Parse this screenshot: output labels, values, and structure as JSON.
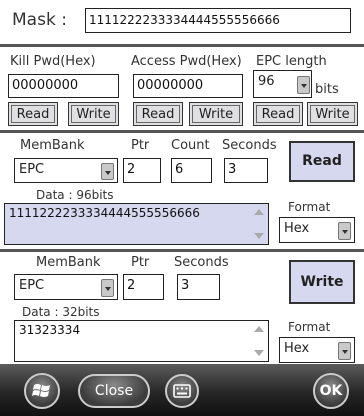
{
  "mask": {
    "label": "Mask :",
    "value": "1111222233334444555556666"
  },
  "kill": {
    "label": "Kill Pwd(Hex)",
    "value": "00000000",
    "read": "Read",
    "write": "Write"
  },
  "access": {
    "label": "Access Pwd(Hex)",
    "value": "00000000",
    "read": "Read",
    "write": "Write"
  },
  "epc": {
    "label": "EPC length",
    "value": "96",
    "unit": "bits",
    "read": "Read",
    "write": "Write"
  },
  "read_section": {
    "membank_label": "MemBank",
    "ptr_label": "Ptr",
    "count_label": "Count",
    "seconds_label": "Seconds",
    "membank": "EPC",
    "ptr": "2",
    "count": "6",
    "seconds": "3",
    "button": "Read",
    "data_label": "Data : 96bits",
    "data": "1111222233334444555556666",
    "format_label": "Format",
    "format": "Hex"
  },
  "write_section": {
    "membank_label": "MemBank",
    "ptr_label": "Ptr",
    "seconds_label": "Seconds",
    "membank": "EPC",
    "ptr": "2",
    "seconds": "3",
    "button": "Write",
    "data_label": "Data : 32bits",
    "data": "31323334",
    "format_label": "Format",
    "format": "Hex"
  },
  "taskbar": {
    "close": "Close",
    "ok": "OK"
  },
  "colors": {
    "accent": "#d6d8ef",
    "taskbar": "#262626",
    "button": "#e0e0e2"
  },
  "icons": {
    "start": "windows-logo-icon",
    "keyboard": "keyboard-icon"
  }
}
